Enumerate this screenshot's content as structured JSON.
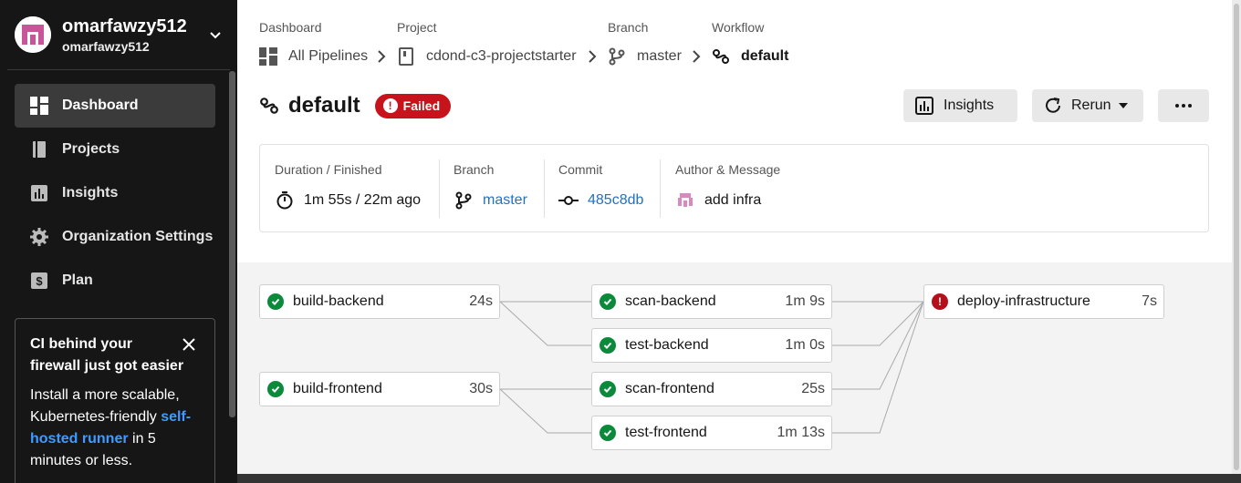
{
  "user": {
    "name": "omarfawzy512",
    "org": "omarfawzy512"
  },
  "nav": [
    {
      "label": "Dashboard",
      "icon": "dashboard-icon",
      "active": true
    },
    {
      "label": "Projects",
      "icon": "book-icon"
    },
    {
      "label": "Insights",
      "icon": "insights-icon"
    },
    {
      "label": "Organization Settings",
      "icon": "gear-icon"
    },
    {
      "label": "Plan",
      "icon": "dollar-icon"
    }
  ],
  "promo": {
    "title": "CI behind your firewall just got easier",
    "body_pre": "Install a more scalable, Kubernetes-friendly ",
    "link": "self-hosted runner",
    "body_post": " in 5 minutes or less."
  },
  "breadcrumbs": [
    {
      "label": "Dashboard",
      "value": "All Pipelines",
      "icon": "pipelines-icon"
    },
    {
      "label": "Project",
      "value": "cdond-c3-projectstarter",
      "icon": "project-icon"
    },
    {
      "label": "Branch",
      "value": "master",
      "icon": "branch-icon"
    },
    {
      "label": "Workflow",
      "value": "default",
      "icon": "workflow-icon"
    }
  ],
  "workflow": {
    "name": "default",
    "status": "Failed"
  },
  "buttons": {
    "insights": "Insights",
    "rerun": "Rerun",
    "more": "more-options"
  },
  "info": {
    "duration_label": "Duration / Finished",
    "duration_value": "1m 55s / 22m ago",
    "branch_label": "Branch",
    "branch_value": "master",
    "commit_label": "Commit",
    "commit_value": "485c8db",
    "author_label": "Author & Message",
    "message": "add infra"
  },
  "jobs": [
    {
      "name": "build-backend",
      "duration": "24s",
      "status": "success"
    },
    {
      "name": "build-frontend",
      "duration": "30s",
      "status": "success"
    },
    {
      "name": "scan-backend",
      "duration": "1m 9s",
      "status": "success"
    },
    {
      "name": "test-backend",
      "duration": "1m 0s",
      "status": "success"
    },
    {
      "name": "scan-frontend",
      "duration": "25s",
      "status": "success"
    },
    {
      "name": "test-frontend",
      "duration": "1m 13s",
      "status": "success"
    },
    {
      "name": "deploy-infrastructure",
      "duration": "7s",
      "status": "failed"
    }
  ],
  "colors": {
    "accent_link": "#1f71c4",
    "failed": "#c7141c",
    "success": "#0a8a3a",
    "sidebar_bg": "#161616"
  }
}
